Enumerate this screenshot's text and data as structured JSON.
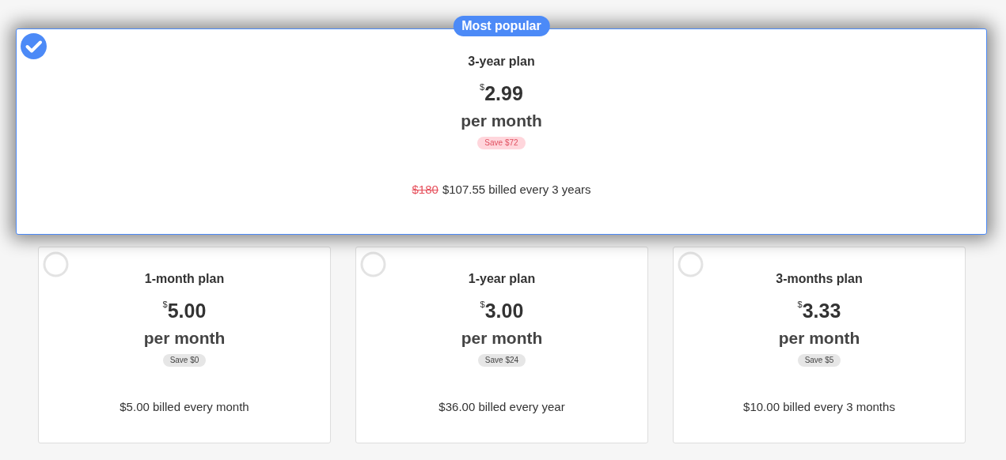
{
  "plans": [
    {
      "featured": true,
      "selected": true,
      "badge": "Most popular",
      "title": "3-year plan",
      "currency": "$",
      "amount": "2.99",
      "period": "per month",
      "savings": "Save $72",
      "old_price": "$180",
      "billing": "$107.55 billed every 3 years"
    },
    {
      "featured": false,
      "selected": false,
      "title": "1-month plan",
      "currency": "$",
      "amount": "5.00",
      "period": "per month",
      "savings": "Save $0",
      "billing": "$5.00 billed every month"
    },
    {
      "featured": false,
      "selected": false,
      "title": "1-year plan",
      "currency": "$",
      "amount": "3.00",
      "period": "per month",
      "savings": "Save $24",
      "billing": "$36.00 billed every year"
    },
    {
      "featured": false,
      "selected": false,
      "title": "3-months plan",
      "currency": "$",
      "amount": "3.33",
      "period": "per month",
      "savings": "Save $5",
      "billing": "$10.00 billed every 3 months"
    }
  ]
}
